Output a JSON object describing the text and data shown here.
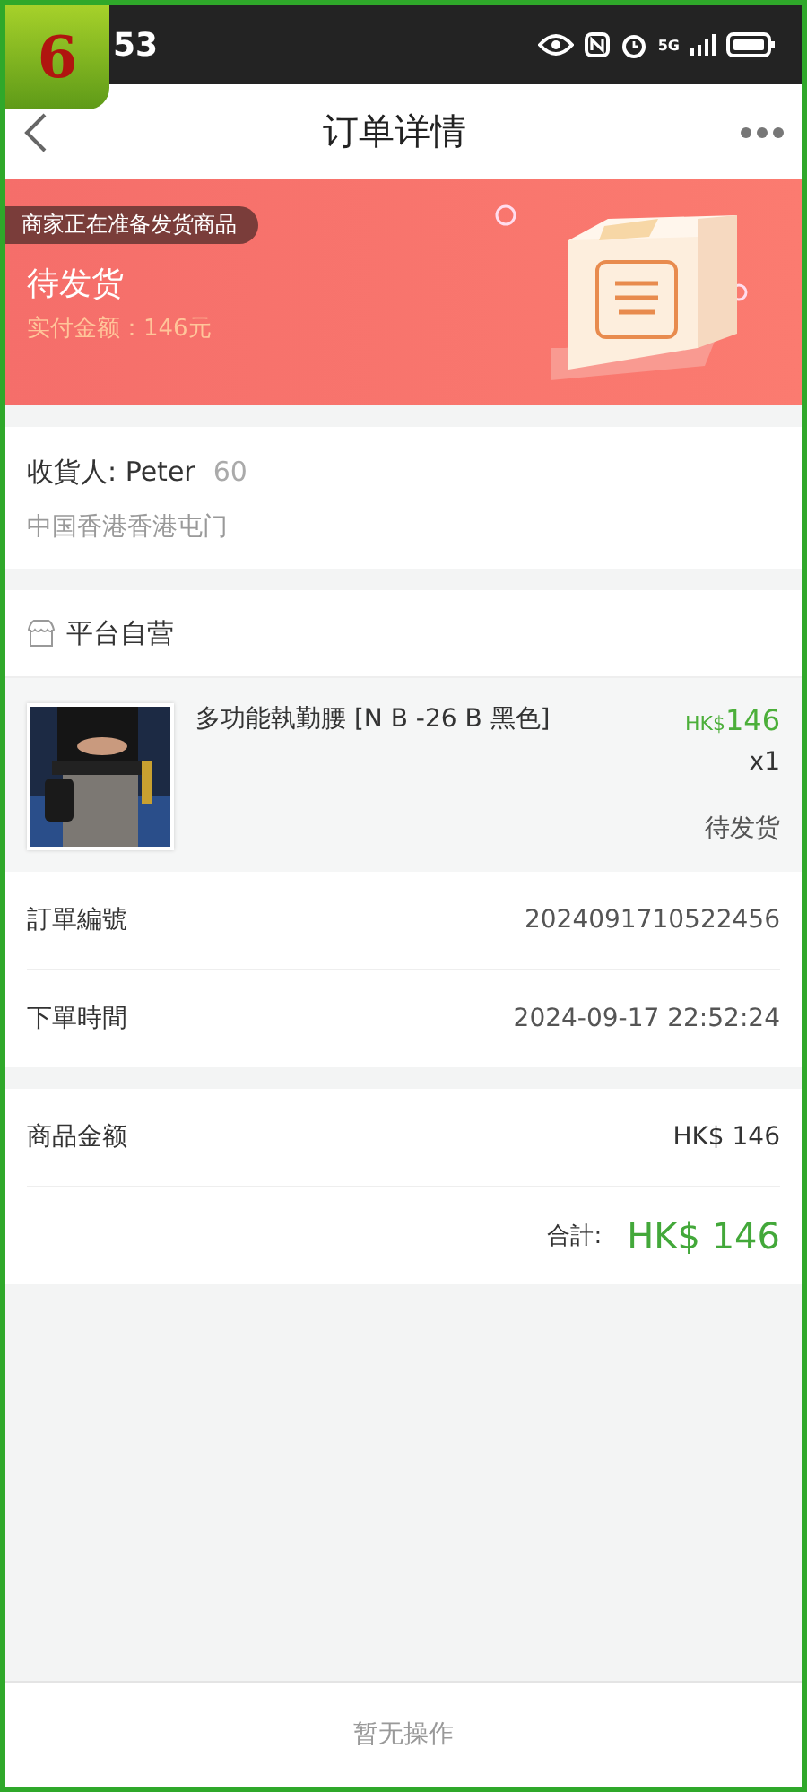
{
  "step_badge": "6",
  "status_bar": {
    "time": "53",
    "network": "5G"
  },
  "nav": {
    "title": "订单详情"
  },
  "banner": {
    "notice": "商家正在准备发货商品",
    "status": "待发货",
    "paid": "实付金额：146元"
  },
  "receiver": {
    "name": "收貨人: Peter",
    "phone": "60",
    "address": "中国香港香港屯门"
  },
  "store": {
    "name": "平台自营"
  },
  "product": {
    "kind": "picture",
    "title": "多功能執勤腰 [N B -26 B 黑色]",
    "currency": "HK$",
    "price": "146",
    "qty": "x1",
    "status": "待发货"
  },
  "order_info": [
    {
      "label": "訂單編號",
      "value": "2024091710522456"
    },
    {
      "label": "下單時間",
      "value": "2024-09-17 22:52:24"
    }
  ],
  "amounts": {
    "label": "商品金额",
    "value": "HK$ 146",
    "total_label": "合計:",
    "total_value": "HK$ 146"
  },
  "bottom_bar": {
    "text": "暂无操作"
  }
}
